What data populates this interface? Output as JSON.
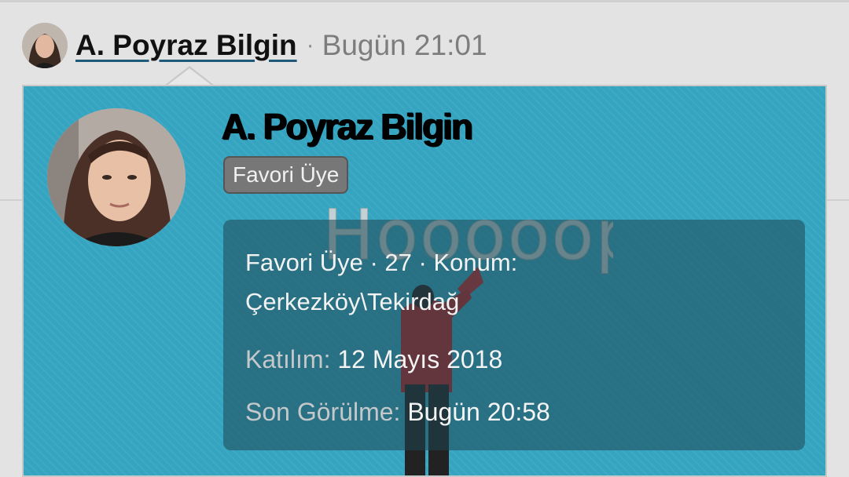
{
  "header": {
    "username": "A. Poyraz Bilgin",
    "separator": "·",
    "post_time": "Bugün 21:01"
  },
  "card": {
    "name": "A. Poyraz Bilgin",
    "role_badge": "Favori Üye",
    "background_text": "Hooooop!",
    "info": {
      "summary_line": "Favori Üye · 27 · Konum: Çerkezköy\\Tekirdağ",
      "joined_label": "Katılım:",
      "joined_value": "12 Mayıs 2018",
      "last_seen_label": "Son Görülme:",
      "last_seen_value": "Bugün 20:58"
    }
  },
  "colors": {
    "card_bg": "#35a4c0",
    "info_box": "#2d5a63",
    "badge_bg": "#777777",
    "link_underline": "#1f5a7a"
  }
}
